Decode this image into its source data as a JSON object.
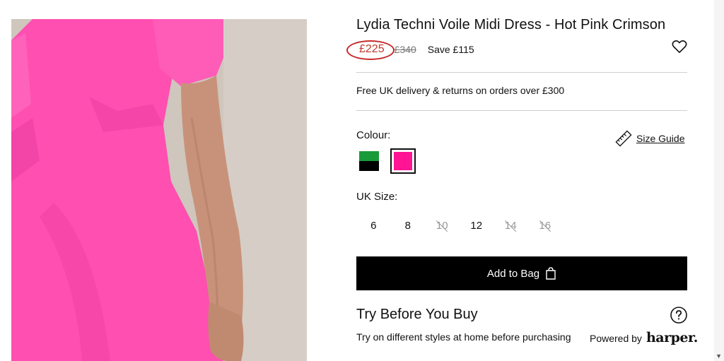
{
  "product": {
    "title": "Lydia Techni Voile Midi Dress - Hot Pink Crimson",
    "price_now": "£225",
    "price_was": "£340",
    "price_save": "Save £115"
  },
  "delivery": {
    "text": "Free UK delivery & returns on orders over £300"
  },
  "colour": {
    "label": "Colour:",
    "swatches": [
      {
        "name": "green-black",
        "colors": [
          "#1a9b3a",
          "#000000"
        ],
        "selected": false
      },
      {
        "name": "hot-pink-crimson",
        "colors": [
          "#ff1493"
        ],
        "selected": true
      }
    ]
  },
  "size_guide": {
    "label": "Size Guide",
    "icon": "ruler-icon"
  },
  "size": {
    "label": "UK Size:",
    "options": [
      {
        "label": "6",
        "available": true
      },
      {
        "label": "8",
        "available": true
      },
      {
        "label": "10",
        "available": false
      },
      {
        "label": "12",
        "available": true
      },
      {
        "label": "14",
        "available": false
      },
      {
        "label": "16",
        "available": false
      }
    ]
  },
  "add_to_bag": {
    "label": "Add to Bag",
    "icon": "shopping-bag-icon"
  },
  "try_before_you_buy": {
    "title": "Try Before You Buy",
    "subtitle": "Try on different styles at home before purchasing",
    "powered_by": "Powered by",
    "partner": "harper."
  },
  "icons": {
    "wishlist": "heart-icon",
    "help": "question-circle-icon"
  }
}
